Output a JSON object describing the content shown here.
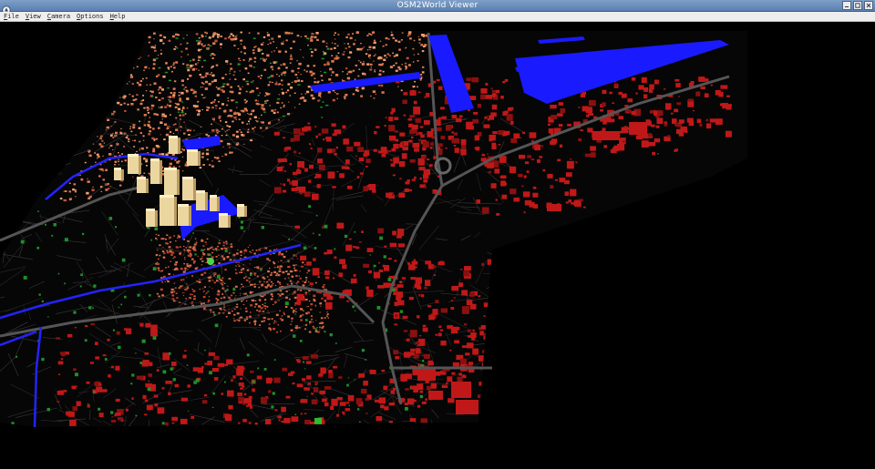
{
  "window": {
    "title": "OSM2World Viewer"
  },
  "menu": [
    {
      "label": "File"
    },
    {
      "label": "View"
    },
    {
      "label": "Camera"
    },
    {
      "label": "Options"
    },
    {
      "label": "Help"
    }
  ],
  "scene": {
    "description_icon": "3d-map-render",
    "colors": {
      "background": "#000000",
      "ground": "#060606",
      "roads": "#4a4a4a",
      "buildings_dense": "#e07a50",
      "buildings_sparse": "#c01818",
      "tall_buildings": "#ecd6a0",
      "water": "#1a1aff",
      "vegetation": "#1f8f2a"
    }
  }
}
